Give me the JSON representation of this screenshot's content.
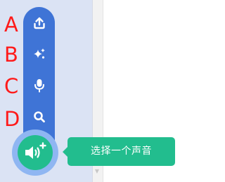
{
  "annotations": {
    "labels": [
      "A",
      "B",
      "C",
      "D"
    ],
    "color": "#ff1a1a"
  },
  "menu": {
    "items": [
      {
        "icon": "upload-icon",
        "label_marker": "A"
      },
      {
        "icon": "sparkle-icon",
        "label_marker": "B"
      },
      {
        "icon": "microphone-icon",
        "label_marker": "C"
      },
      {
        "icon": "search-icon",
        "label_marker": "D"
      }
    ],
    "color": "#3f74d6"
  },
  "fab": {
    "icon": "add-sound-icon",
    "color": "#22bd8e"
  },
  "tooltip": {
    "text": "选择一个声音"
  }
}
